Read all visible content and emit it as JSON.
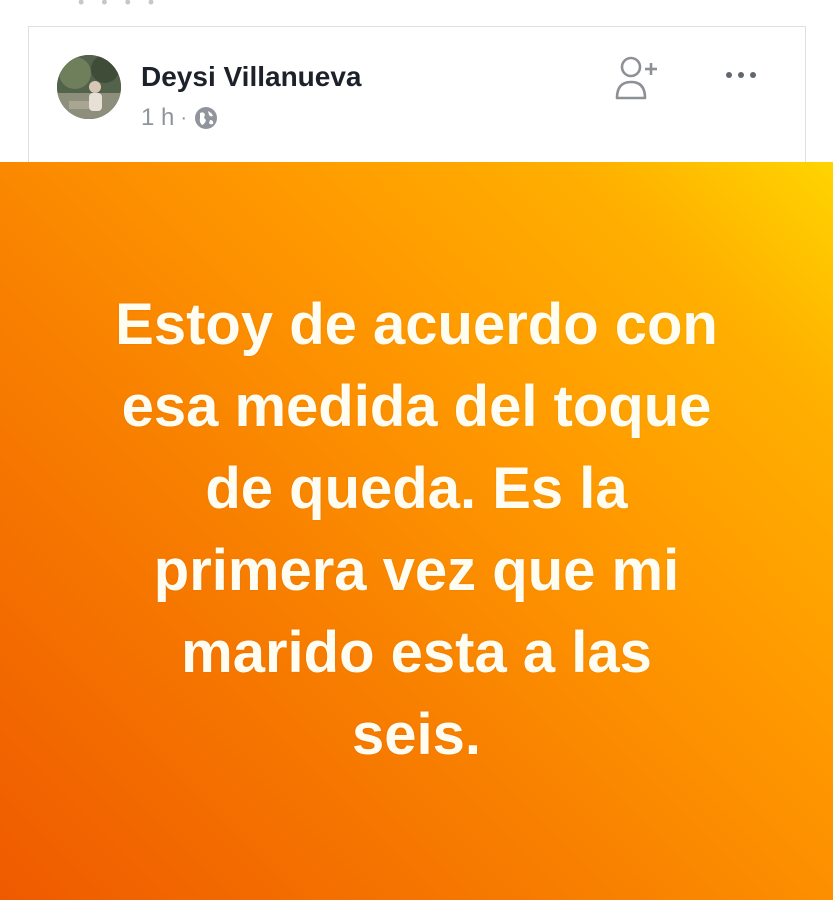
{
  "post": {
    "author": "Deysi Villanueva",
    "time": "1 h",
    "separator": "·",
    "privacy_icon": "globe-icon",
    "add_friend_icon": "add-friend-icon",
    "more_icon": "more-options-icon",
    "body_lines": [
      "Estoy de acuerdo con",
      "esa medida del toque",
      "de queda. Es la",
      "primera vez que mi",
      "marido esta a las",
      "seis."
    ],
    "background_colors": [
      "#ffd400",
      "#ff9800",
      "#ef5a00"
    ],
    "text_color": "#fffdf2"
  }
}
